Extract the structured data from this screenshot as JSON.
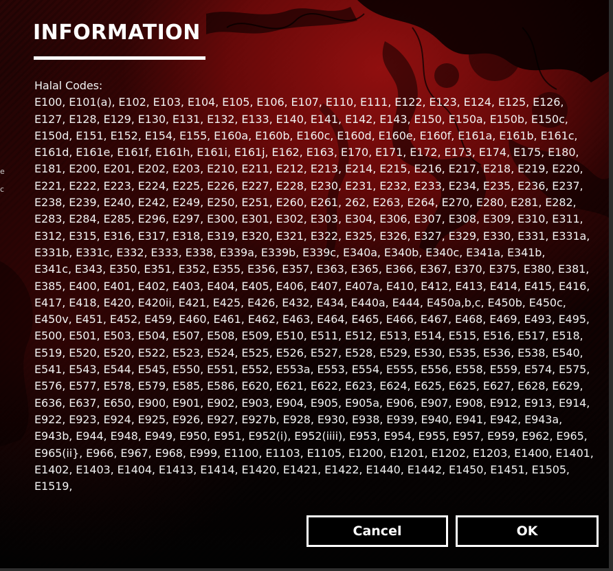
{
  "dialog": {
    "title": "INFORMATION",
    "heading": "Halal Codes:",
    "lines": [
      "E100, E101(a), E102, E103, E104, E105, E106, E107, E110, E111, E122, E123, E124, E125, E126,",
      "E127, E128, E129, E130, E131, E132, E133, E140, E141, E142, E143, E150, E150a, E150b, E150c,",
      "E150d, E151, E152, E154, E155, E160a, E160b, E160c, E160d, E160e, E160f, E161a, E161b, E161c,",
      "E161d, E161e, E161f, E161h, E161i, E161j, E162, E163, E170, E171, E172, E173, E174, E175, E180,",
      "E181, E200, E201, E202, E203, E210, E211, E212, E213, E214, E215, E216, E217, E218, E219, E220,",
      "E221, E222, E223, E224, E225, E226, E227, E228, E230, E231, E232, E233, E234, E235, E236, E237,",
      "E238, E239, E240, E242, E249, E250, E251, E260, E261, 262, E263, E264, E270, E280, E281, E282,",
      "E283, E284, E285, E296, E297, E300, E301, E302, E303, E304, E306, E307, E308, E309, E310, E311,",
      "E312, E315, E316, E317, E318, E319, E320, E321, E322, E325, E326, E327, E329, E330, E331, E331a,",
      "E331b, E331c, E332, E333, E338, E339a, E339b, E339c, E340a, E340b, E340c, E341a, E341b,",
      "E341c, E343, E350, E351, E352, E355, E356, E357, E363, E365, E366, E367, E370, E375, E380, E381,",
      "E385, E400, E401, E402, E403, E404, E405, E406, E407, E407a, E410, E412, E413, E414, E415, E416,",
      "E417, E418, E420, E420ii, E421, E425, E426, E432, E434, E440a, E444, E450a,b,c, E450b, E450c,",
      "E450v, E451, E452, E459, E460, E461, E462, E463, E464, E465, E466, E467, E468, E469, E493, E495,",
      "E500, E501, E503, E504, E507, E508, E509, E510, E511, E512, E513, E514, E515, E516, E517, E518,",
      "E519, E520, E520, E522, E523, E524, E525, E526, E527, E528, E529, E530, E535, E536, E538, E540,",
      "E541, E543, E544, E545, E550, E551, E552, E553a, E553, E554, E555, E556, E558, E559, E574, E575,",
      "E576, E577, E578, E579, E585, E586, E620, E621, E622, E623, E624, E625, E625, E627, E628, E629,",
      "E636, E637, E650, E900, E901, E902, E903, E904, E905, E905a, E906, E907, E908, E912, E913, E914,",
      "E922, E923, E924, E925, E926, E927, E927b, E928, E930, E938, E939, E940, E941, E942, E943a,",
      "E943b, E944, E948, E949, E950, E951, E952(i), E952(iiii), E953, E954, E955, E957, E959, E962, E965,",
      "E965(ii}, E966, E967, E968, E999, E1100, E1103, E1105, E1200, E1201, E1202, E1203, E1400, E1401,",
      "E1402, E1403, E1404, E1413, E1414, E1420, E1421, E1422, E1440, E1442, E1450, E1451, E1505,",
      "E1519,"
    ]
  },
  "buttons": {
    "cancel_label": "Cancel",
    "ok_label": "OK"
  },
  "edge_fragments": [
    "e",
    "c"
  ],
  "colors": {
    "accent_red": "#8e1010",
    "background": "#0a0a0a",
    "text": "#ffffff"
  }
}
